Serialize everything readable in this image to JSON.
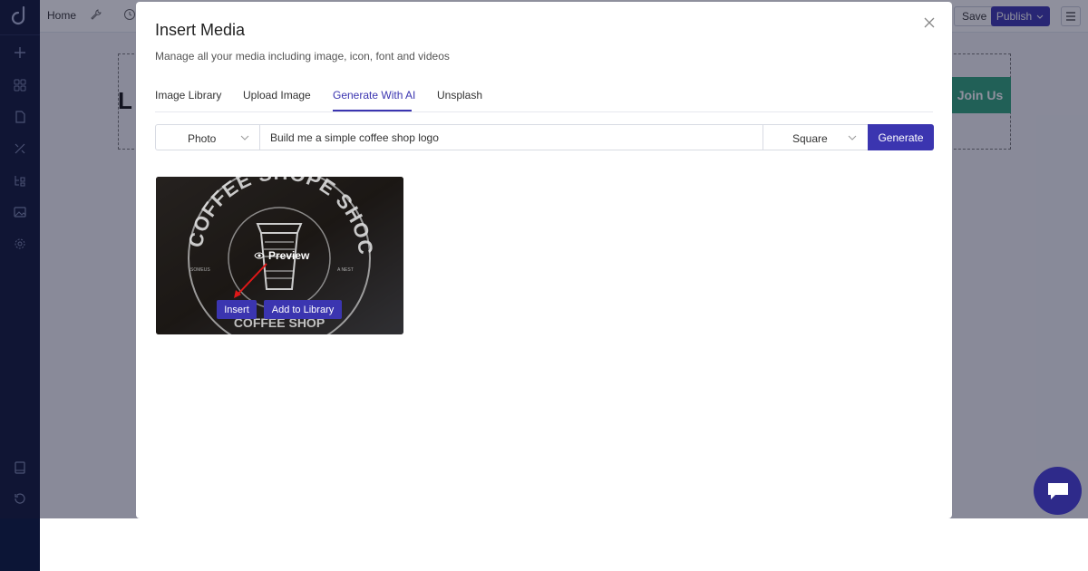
{
  "topbar": {
    "home_label": "Home",
    "save_label": "Save",
    "publish_label": "Publish"
  },
  "canvas": {
    "join_label": "Join Us",
    "heading_fragment": "L"
  },
  "modal": {
    "title": "Insert Media",
    "subtitle": "Manage all your media including image, icon, font and videos",
    "tabs": [
      {
        "label": "Image Library",
        "active": false
      },
      {
        "label": "Upload Image",
        "active": false
      },
      {
        "label": "Generate With AI",
        "active": true
      },
      {
        "label": "Unsplash",
        "active": false
      }
    ],
    "generator": {
      "type_value": "Photo",
      "prompt_value": "Build me a simple coffee shop logo",
      "ratio_value": "Square",
      "generate_label": "Generate"
    },
    "result": {
      "logo_top_text": "COFFEE SHOPE SHOC",
      "logo_bottom_text": "COFFEE SHOP",
      "preview_label": "Preview",
      "insert_label": "Insert",
      "add_library_label": "Add to Library"
    }
  },
  "colors": {
    "accent": "#3b35b0",
    "sidebar_bg": "#0c1536",
    "join_button": "#2da37a"
  }
}
